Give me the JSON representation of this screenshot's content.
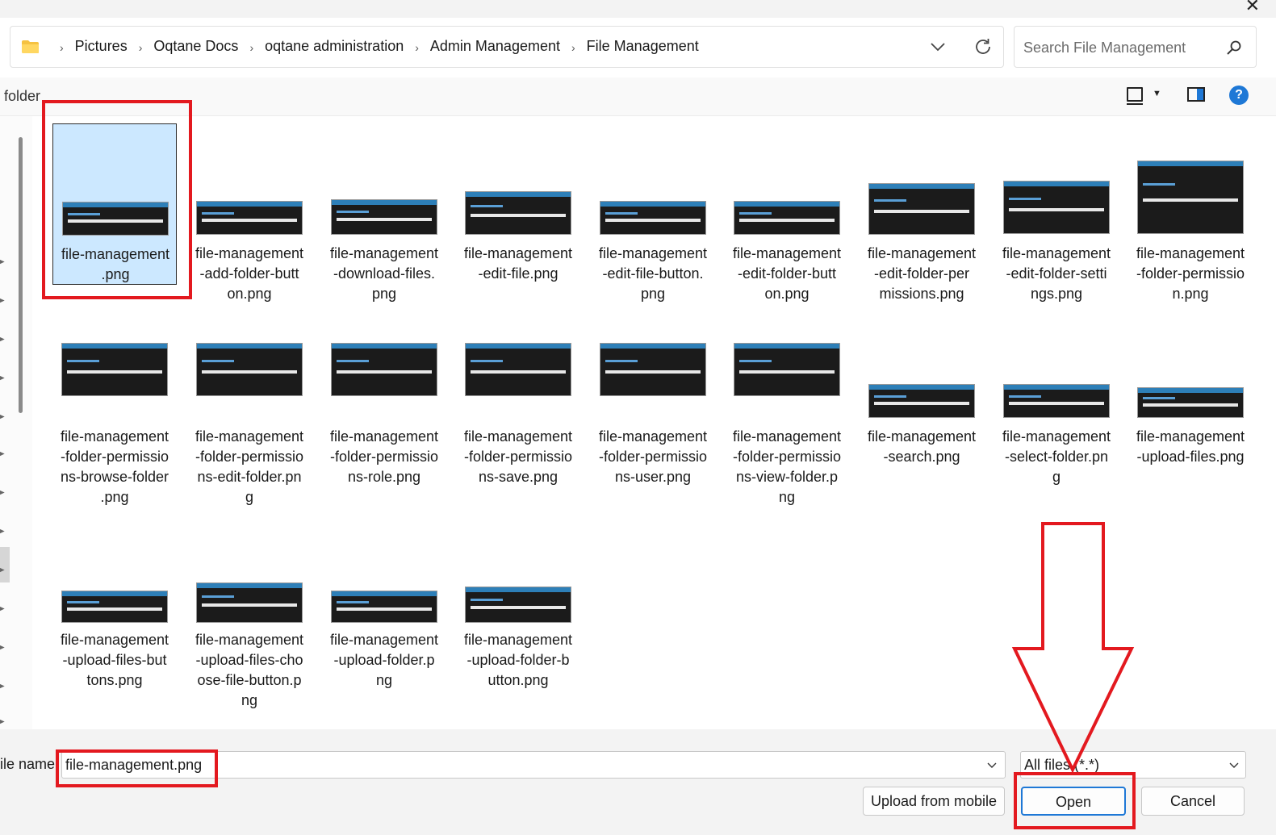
{
  "window": {
    "close_glyph": "✕"
  },
  "address_bar": {
    "folder_icon": "folder-icon",
    "crumbs": [
      "Pictures",
      "Oqtane Docs",
      "oqtane administration",
      "Admin Management",
      "File Management"
    ],
    "separator": "›",
    "dropdown_icon": "chevron-down-icon",
    "refresh_icon": "refresh-icon"
  },
  "search": {
    "placeholder": "Search File Management",
    "icon": "search-icon"
  },
  "toolbar": {
    "label": "folder",
    "view_icon": "view-icon",
    "preview_pane_icon": "preview-pane-icon",
    "help_icon": "help-icon",
    "help_glyph": "?"
  },
  "files": [
    {
      "name": "file-management\n.png",
      "selected": true
    },
    {
      "name": "file-management\n-add-folder-butt\non.png"
    },
    {
      "name": "file-management\n-download-files.\npng"
    },
    {
      "name": "file-management\n-edit-file.png"
    },
    {
      "name": "file-management\n-edit-file-button.\npng"
    },
    {
      "name": "file-management\n-edit-folder-butt\non.png"
    },
    {
      "name": "file-management\n-edit-folder-per\nmissions.png"
    },
    {
      "name": "file-management\n-edit-folder-setti\nngs.png"
    },
    {
      "name": "file-management\n-folder-permissio\nn.png"
    },
    {
      "name": "file-management\n-folder-permissio\nns-browse-folder\n.png"
    },
    {
      "name": "file-management\n-folder-permissio\nns-edit-folder.pn\ng"
    },
    {
      "name": "file-management\n-folder-permissio\nns-role.png"
    },
    {
      "name": "file-management\n-folder-permissio\nns-save.png"
    },
    {
      "name": "file-management\n-folder-permissio\nns-user.png"
    },
    {
      "name": "file-management\n-folder-permissio\nns-view-folder.p\nng"
    },
    {
      "name": "file-management\n-search.png"
    },
    {
      "name": "file-management\n-select-folder.pn\ng"
    },
    {
      "name": "file-management\n-upload-files.png"
    },
    {
      "name": "file-management\n-upload-files-but\ntons.png"
    },
    {
      "name": "file-management\n-upload-files-cho\nose-file-button.p\nng"
    },
    {
      "name": "file-management\n-upload-folder.p\nng"
    },
    {
      "name": "file-management\n-upload-folder-b\nutton.png"
    }
  ],
  "footer": {
    "file_name_label": "ile name:",
    "file_name_value": "file-management.png",
    "file_type_value": "All files (*.*)",
    "upload_button": "Upload from mobile",
    "open_button": "Open",
    "cancel_button": "Cancel"
  },
  "colors": {
    "accent": "#1e78d6",
    "selection": "#cce8ff",
    "annotation_red": "#e3191f"
  }
}
